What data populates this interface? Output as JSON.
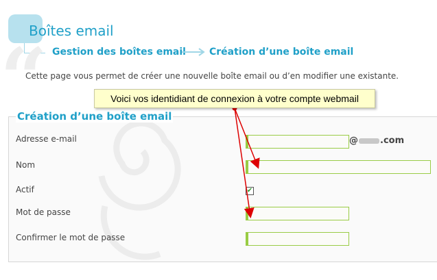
{
  "page": {
    "title": "Boîtes email",
    "breadcrumb": [
      "Gestion des boîtes email",
      "Création d’une boîte email"
    ],
    "intro": "Cette page vous permet de créer une nouvelle boîte email ou d’en modifier une existante."
  },
  "tooltip": {
    "text": "Voici vos identidiant de connexion à votre compte webmail"
  },
  "form": {
    "legend": "Création d’une boîte email",
    "email_label": "Adresse e-mail",
    "email_value": "",
    "email_domain_prefix": "@",
    "email_domain_suffix": ".com",
    "name_label": "Nom",
    "name_value": "",
    "active_label": "Actif",
    "active_checked": true,
    "password_label": "Mot de passe",
    "password_value": "",
    "confirm_label": "Confirmer le mot de passe",
    "confirm_value": ""
  },
  "colors": {
    "accent": "#20a0c8",
    "input_border": "#99cc44",
    "annotation": "#dd0000",
    "tooltip_bg": "#ffffcc"
  }
}
